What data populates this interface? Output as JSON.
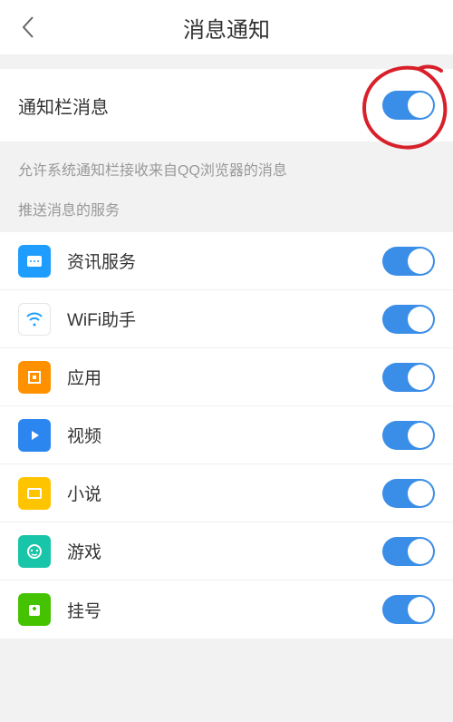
{
  "header": {
    "title": "消息通知"
  },
  "main_toggle": {
    "label": "通知栏消息",
    "on": true
  },
  "description": "允许系统通知栏接收来自QQ浏览器的消息",
  "section_header": "推送消息的服务",
  "items": [
    {
      "icon": "news",
      "label": "资讯服务",
      "on": true
    },
    {
      "icon": "wifi",
      "label": "WiFi助手",
      "on": true
    },
    {
      "icon": "app",
      "label": "应用",
      "on": true
    },
    {
      "icon": "video",
      "label": "视频",
      "on": true
    },
    {
      "icon": "novel",
      "label": "小说",
      "on": true
    },
    {
      "icon": "game",
      "label": "游戏",
      "on": true
    },
    {
      "icon": "reg",
      "label": "挂号",
      "on": true
    }
  ],
  "annotation": {
    "circle_on_main_toggle": true,
    "color": "#d8202a"
  }
}
